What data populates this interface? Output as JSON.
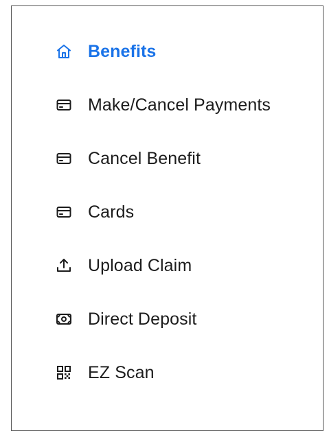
{
  "colors": {
    "active": "#1a73e8",
    "text": "#1c1c1c",
    "border": "#555555"
  },
  "menu": {
    "items": [
      {
        "label": "Benefits",
        "icon": "home-icon",
        "active": true
      },
      {
        "label": "Make/Cancel Payments",
        "icon": "card-icon",
        "active": false
      },
      {
        "label": "Cancel Benefit",
        "icon": "card-icon",
        "active": false
      },
      {
        "label": "Cards",
        "icon": "card-icon",
        "active": false
      },
      {
        "label": "Upload Claim",
        "icon": "upload-icon",
        "active": false
      },
      {
        "label": "Direct Deposit",
        "icon": "cash-icon",
        "active": false
      },
      {
        "label": "EZ Scan",
        "icon": "qr-code-icon",
        "active": false
      }
    ]
  }
}
